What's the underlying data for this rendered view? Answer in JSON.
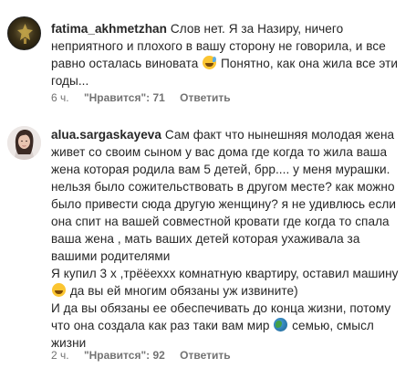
{
  "comments": [
    {
      "username": "fatima_akhmetzhan",
      "lines": [
        "Слов нет. Я за Назиру, ничего",
        "неприятного и плохого в вашу сторону не говорила, и все",
        "равно осталась виновата",
        " Понятно, как она жила все эти",
        "годы..."
      ],
      "emoji_after_line3": "sweat-smile-emoji",
      "time": "6 ч.",
      "likes": "\"Нравится\": 71",
      "reply": "Ответить"
    },
    {
      "username": "alua.sargaskayeva",
      "lines": [
        "Сам факт что нынешняя молодая жена",
        "живет со своим сыном у вас дома где когда то жила ваша",
        "жена которая родила вам 5 детей, брр.... у меня мурашки.",
        "нельзя было сожительствовать в другом месте? как можно",
        "было привести сюда другую женщину? я не удивлюсь если",
        "она спит на вашей совместной кровати где когда то спала",
        "ваша жена , мать ваших детей которая ухаживала за",
        "вашими родителями",
        "Я купил 3 х ,трёёеххх комнатную квартиру, оставил машину",
        " да вы ей многим обязаны уж извините)",
        "И да вы обязаны ее обеспечивать до конца жизни, потому",
        "что она создала как раз таки вам мир",
        " семью, смысл",
        "жизни"
      ],
      "time": "2 ч.",
      "likes": "\"Нравится\": 92",
      "reply": "Ответить"
    }
  ],
  "icons": {
    "emoji1": "sweat-smile-emoji",
    "emoji2": "grinning-emoji",
    "emoji3": "globe-emoji"
  }
}
